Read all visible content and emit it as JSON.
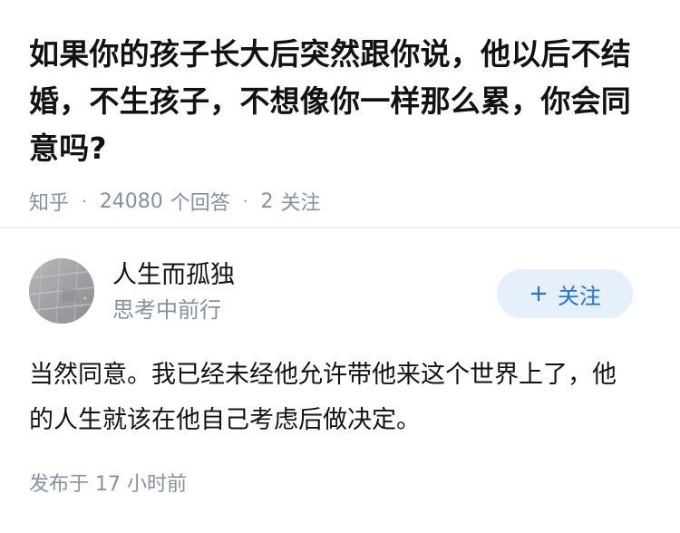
{
  "question": {
    "title": "如果你的孩子长大后突然跟你说，他以后不结婚，不生孩子，不想像你一样那么累，你会同意吗?",
    "source": "知乎",
    "answer_count": "24080",
    "answer_label": "个回答",
    "follower_count": "2",
    "follower_label": "关注",
    "separator": "·"
  },
  "author": {
    "name": "人生而孤独",
    "headline": "思考中前行",
    "follow_button": {
      "icon": "+",
      "label": "关注"
    }
  },
  "answer": {
    "content": "当然同意。我已经未经他允许带他来这个世界上了，他的人生就该在他自己考虑后做决定。",
    "published_label": "发布于",
    "published_time": "17 小时前"
  },
  "colors": {
    "primary": "#1772f6",
    "follow_bg": "#e6f0fb",
    "text": "#121212",
    "muted": "#8590a6"
  }
}
